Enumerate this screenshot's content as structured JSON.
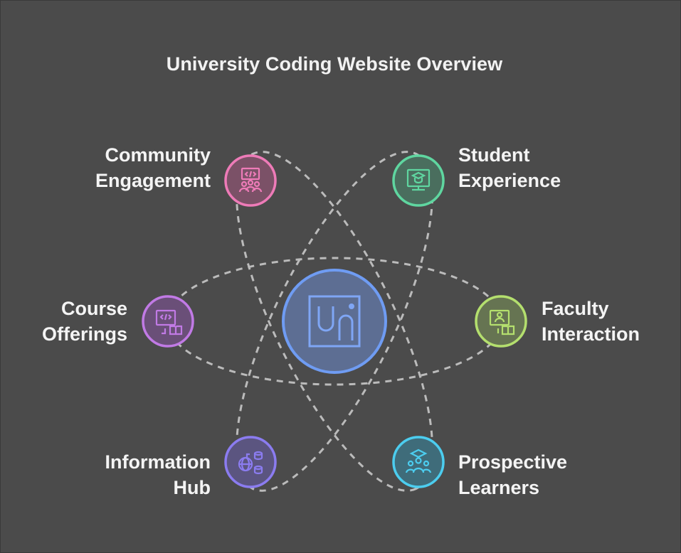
{
  "title": "University Coding Website Overview",
  "center": {
    "label": "UNi-icon",
    "color": "#6f9cf3"
  },
  "nodes": [
    {
      "id": "community",
      "lines": [
        "Community",
        "Engagement"
      ],
      "color": "#ee7bb8",
      "icon": "code-presentation-people-icon"
    },
    {
      "id": "student",
      "lines": [
        "Student",
        "Experience"
      ],
      "color": "#5fd6a0",
      "icon": "graduate-monitor-icon"
    },
    {
      "id": "course",
      "lines": [
        "Course",
        "Offerings"
      ],
      "color": "#c17ae5",
      "icon": "code-monitor-book-icon"
    },
    {
      "id": "faculty",
      "lines": [
        "Faculty",
        "Interaction"
      ],
      "color": "#b4df6e",
      "icon": "teacher-monitor-book-icon"
    },
    {
      "id": "info",
      "lines": [
        "Information",
        "Hub"
      ],
      "color": "#8b7cf0",
      "icon": "globe-database-icon"
    },
    {
      "id": "prospective",
      "lines": [
        "Prospective",
        "Learners"
      ],
      "color": "#4ccdef",
      "icon": "graduate-group-icon"
    }
  ]
}
